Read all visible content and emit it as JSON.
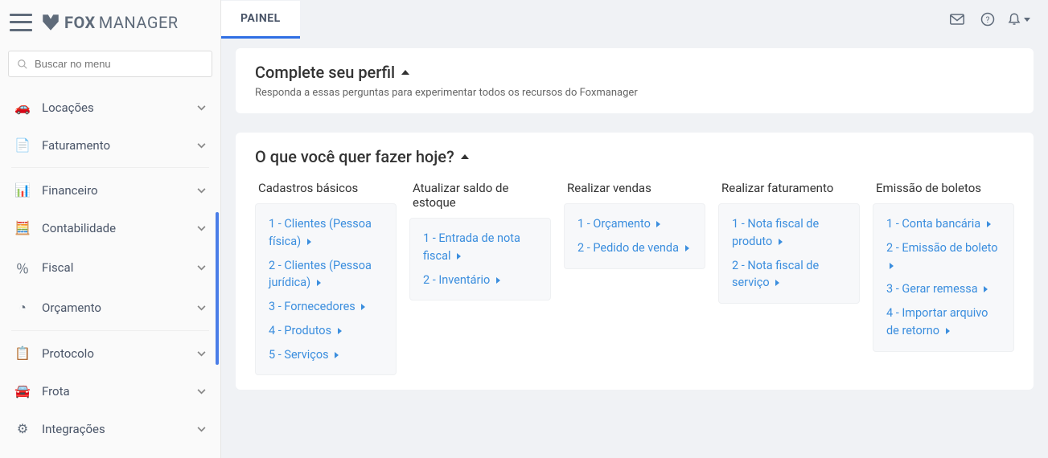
{
  "brand": {
    "part1": "FOX",
    "part2": "MANAGER"
  },
  "search": {
    "placeholder": "Buscar no menu"
  },
  "sidebar": {
    "groups": [
      {
        "items": [
          {
            "id": "locacoes",
            "label": "Locações",
            "icon": "🚗"
          },
          {
            "id": "faturamento",
            "label": "Faturamento",
            "icon": "📄"
          }
        ]
      },
      {
        "items": [
          {
            "id": "financeiro",
            "label": "Financeiro",
            "icon": "📊"
          },
          {
            "id": "contabilidade",
            "label": "Contabilidade",
            "icon": "🧮"
          },
          {
            "id": "fiscal",
            "label": "Fiscal",
            "icon": "％"
          },
          {
            "id": "orcamento",
            "label": "Orçamento",
            "icon": "◔"
          }
        ]
      },
      {
        "items": [
          {
            "id": "protocolo",
            "label": "Protocolo",
            "icon": "📋"
          },
          {
            "id": "frota",
            "label": "Frota",
            "icon": "🚘"
          },
          {
            "id": "integracoes",
            "label": "Integrações",
            "icon": "⚙"
          }
        ]
      }
    ]
  },
  "tab": {
    "label": "PAINEL"
  },
  "profile_card": {
    "title": "Complete seu perfil",
    "subtitle": "Responda a essas perguntas para experimentar todos os recursos do Foxmanager"
  },
  "today_card": {
    "title": "O que você quer fazer hoje?",
    "columns": [
      {
        "title": "Cadastros básicos",
        "links": [
          "1 - Clientes (Pessoa física)",
          "2 - Clientes (Pessoa jurídica)",
          "3 - Fornecedores",
          "4 - Produtos",
          "5 - Serviços"
        ]
      },
      {
        "title": "Atualizar saldo de estoque",
        "links": [
          "1 - Entrada de nota fiscal",
          "2 - Inventário"
        ]
      },
      {
        "title": "Realizar vendas",
        "links": [
          "1 - Orçamento",
          "2 - Pedido de venda"
        ]
      },
      {
        "title": "Realizar faturamento",
        "links": [
          "1 - Nota fiscal de produto",
          "2 - Nota fiscal de serviço"
        ]
      },
      {
        "title": "Emissão de boletos",
        "links": [
          "1 - Conta bancária",
          "2 - Emissão de boleto",
          "3 - Gerar remessa",
          "4 - Importar arquivo de retorno"
        ]
      }
    ]
  }
}
